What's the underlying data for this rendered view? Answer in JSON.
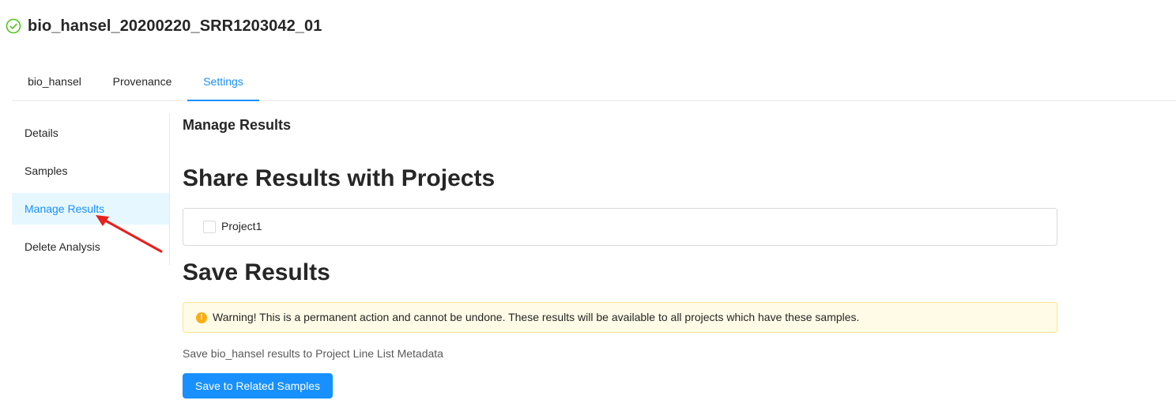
{
  "header": {
    "title": "bio_hansel_20200220_SRR1203042_01",
    "status_icon": "check-circle-icon",
    "status_color": "#52c41a"
  },
  "tabs": [
    {
      "label": "bio_hansel",
      "active": false
    },
    {
      "label": "Provenance",
      "active": false
    },
    {
      "label": "Settings",
      "active": true
    }
  ],
  "sidenav": {
    "items": [
      {
        "label": "Details",
        "selected": false
      },
      {
        "label": "Samples",
        "selected": false
      },
      {
        "label": "Manage Results",
        "selected": true
      },
      {
        "label": "Delete Analysis",
        "selected": false
      }
    ]
  },
  "main": {
    "section_title": "Manage Results",
    "share_heading": "Share Results with Projects",
    "projects": [
      {
        "label": "Project1",
        "checked": false
      }
    ],
    "save_heading": "Save Results",
    "warning": {
      "icon": "exclamation-circle-icon",
      "text": "Warning! This is a permanent action and cannot be undone. These results will be available to all projects which have these samples."
    },
    "save_description": "Save bio_hansel results to Project Line List Metadata",
    "save_button_label": "Save to Related Samples"
  },
  "colors": {
    "accent": "#1890ff",
    "selected_bg": "#e6f7ff",
    "warning_bg": "#fffbe6",
    "warning_border": "#ffe58f",
    "warning_icon": "#faad14",
    "annotation_arrow": "#e8201c"
  }
}
